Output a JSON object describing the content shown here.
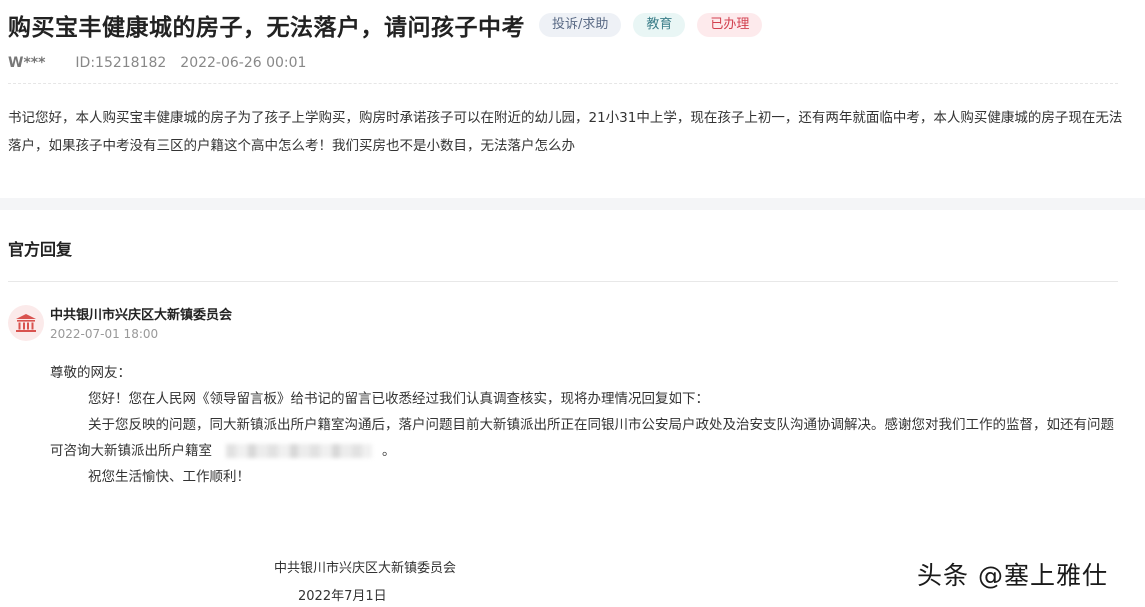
{
  "post": {
    "title": "购买宝丰健康城的房子，无法落户，请问孩子中考",
    "tags": {
      "type": "投诉/求助",
      "category": "教育",
      "status": "已办理"
    },
    "user": "W***",
    "id": "ID:15218182",
    "datetime": "2022-06-26 00:01",
    "content": "书记您好，本人购买宝丰健康城的房子为了孩子上学购买，购房时承诺孩子可以在附近的幼儿园，21小31中上学，现在孩子上初一，还有两年就面临中考，本人购买健康城的房子现在无法落户，如果孩子中考没有三区的户籍这个高中怎么考！我们买房也不是小数目，无法落户怎么办"
  },
  "reply_section": {
    "title": "官方回复",
    "org": "中共银川市兴庆区大新镇委员会",
    "datetime": "2022-07-01 18:00",
    "greeting": "尊敬的网友：",
    "para1": "您好！您在人民网《领导留言板》给书记的留言已收悉经过我们认真调查核实，现将办理情况回复如下：",
    "para2": "关于您反映的问题，同大新镇派出所户籍室沟通后，落户问题目前大新镇派出所正在同银川市公安局户政处及治安支队沟通协调解决。感谢您对我们工作的监督，如还有问题可咨询大新镇派出所户籍室",
    "para2_end": "。",
    "closing": "祝您生活愉快、工作顺利！",
    "sign_org": "中共银川市兴庆区大新镇委员会",
    "sign_date": "2022年7月1日"
  },
  "watermark": "头条 @塞上雅仕",
  "icons": {
    "avatar": "government-building-icon"
  },
  "colors": {
    "status_red": "#d2404f",
    "avatar_bg": "#fbeaea",
    "avatar_icon": "#d9534f"
  }
}
